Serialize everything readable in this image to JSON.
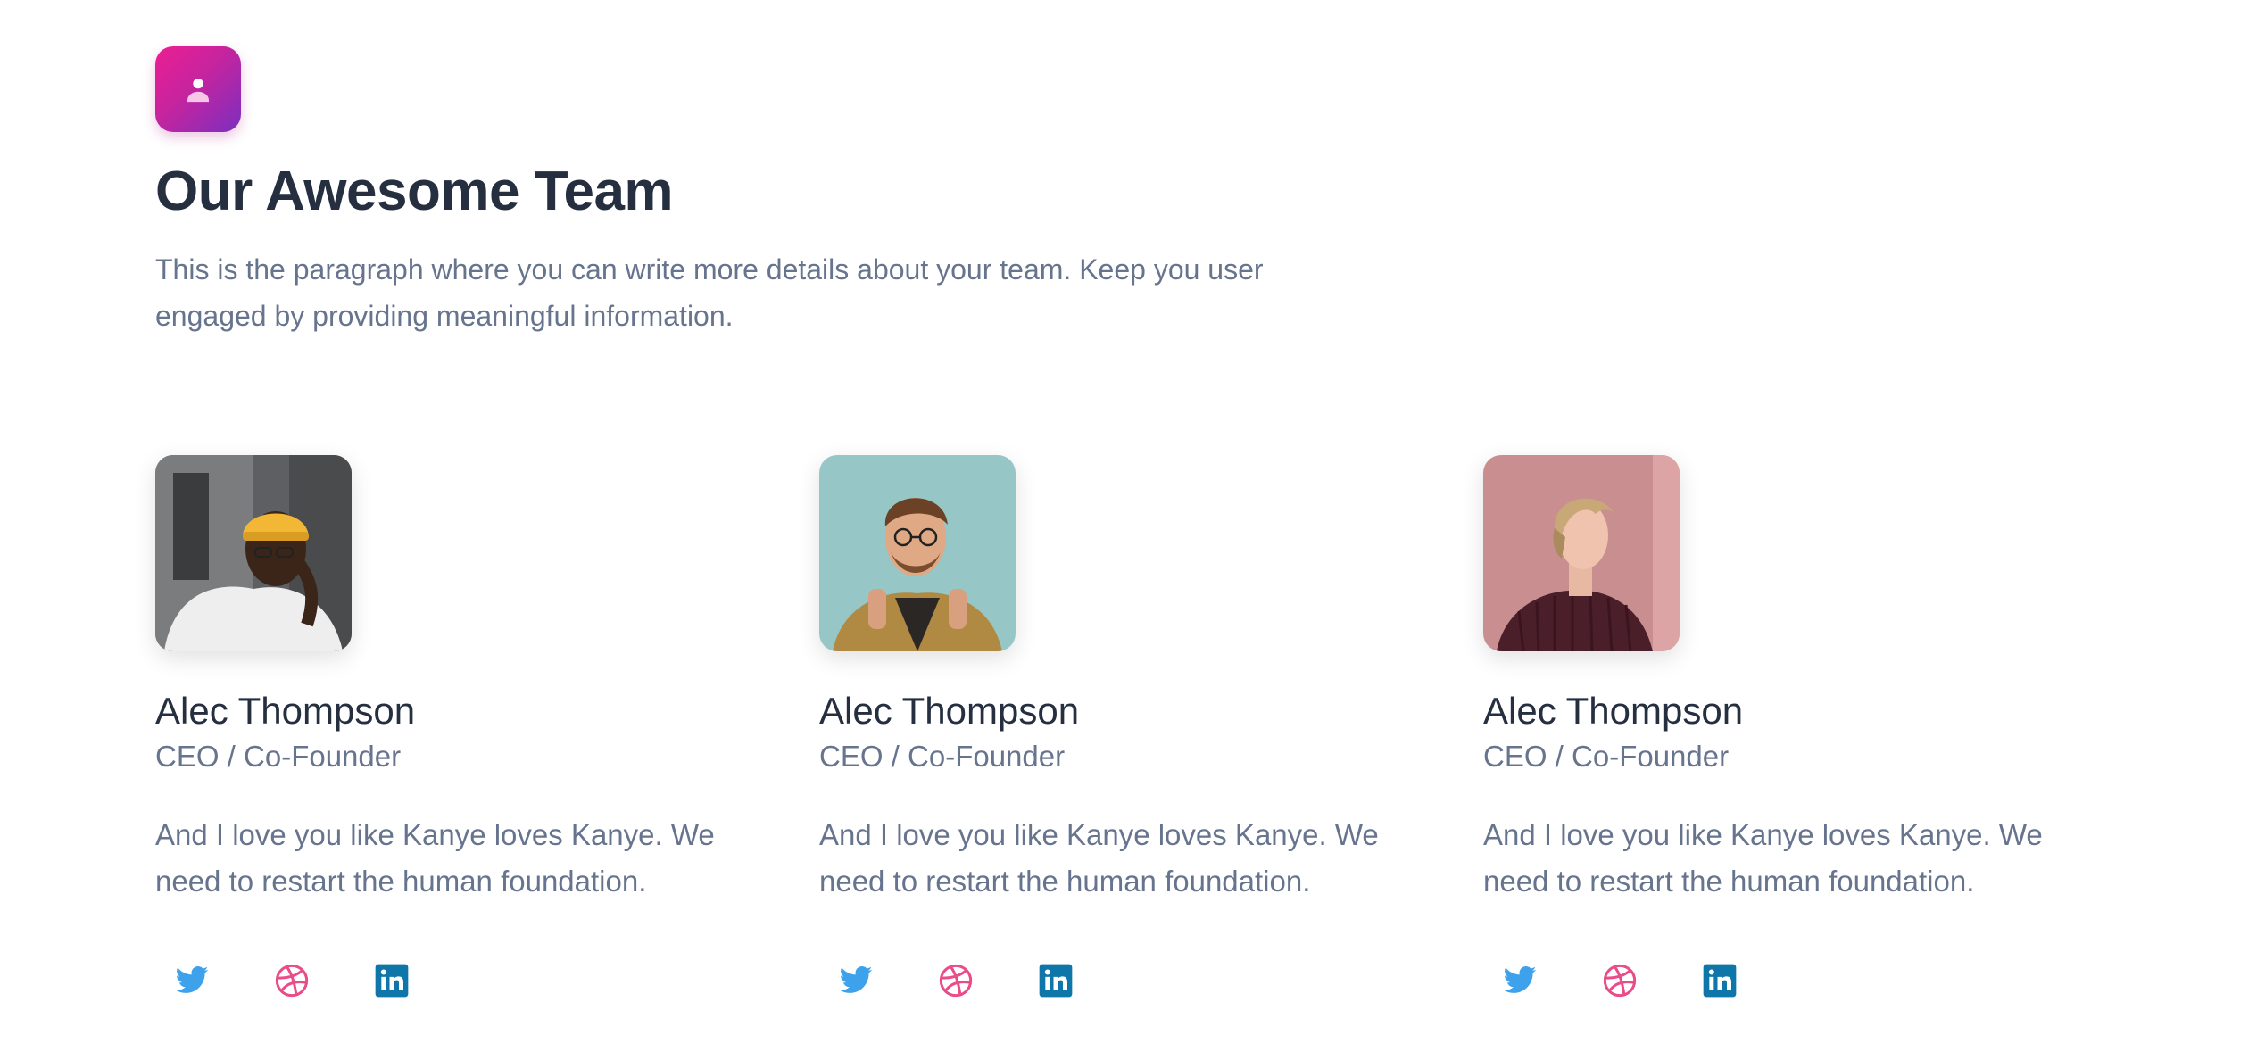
{
  "header": {
    "title": "Our Awesome Team",
    "description": "This is the paragraph where you can write more details about your team. Keep you user engaged by providing meaningful information.",
    "icon": "user-icon",
    "icon_gradient": [
      "#ec1e93",
      "#7b2fbf"
    ]
  },
  "team": [
    {
      "name": "Alec Thompson",
      "role": "CEO / Co-Founder",
      "bio": "And I love you like Kanye loves Kanye. We need to restart the human foundation.",
      "socials": [
        "twitter-icon",
        "dribbble-icon",
        "linkedin-icon"
      ]
    },
    {
      "name": "Alec Thompson",
      "role": "CEO / Co-Founder",
      "bio": "And I love you like Kanye loves Kanye. We need to restart the human foundation.",
      "socials": [
        "twitter-icon",
        "dribbble-icon",
        "linkedin-icon"
      ]
    },
    {
      "name": "Alec Thompson",
      "role": "CEO / Co-Founder",
      "bio": "And I love you like Kanye loves Kanye. We need to restart the human foundation.",
      "socials": [
        "twitter-icon",
        "dribbble-icon",
        "linkedin-icon"
      ]
    }
  ],
  "colors": {
    "heading": "#252f40",
    "text": "#67748e",
    "twitter": "#3ea1ec",
    "dribbble": "#ea4c89",
    "linkedin": "#0e76a8"
  }
}
